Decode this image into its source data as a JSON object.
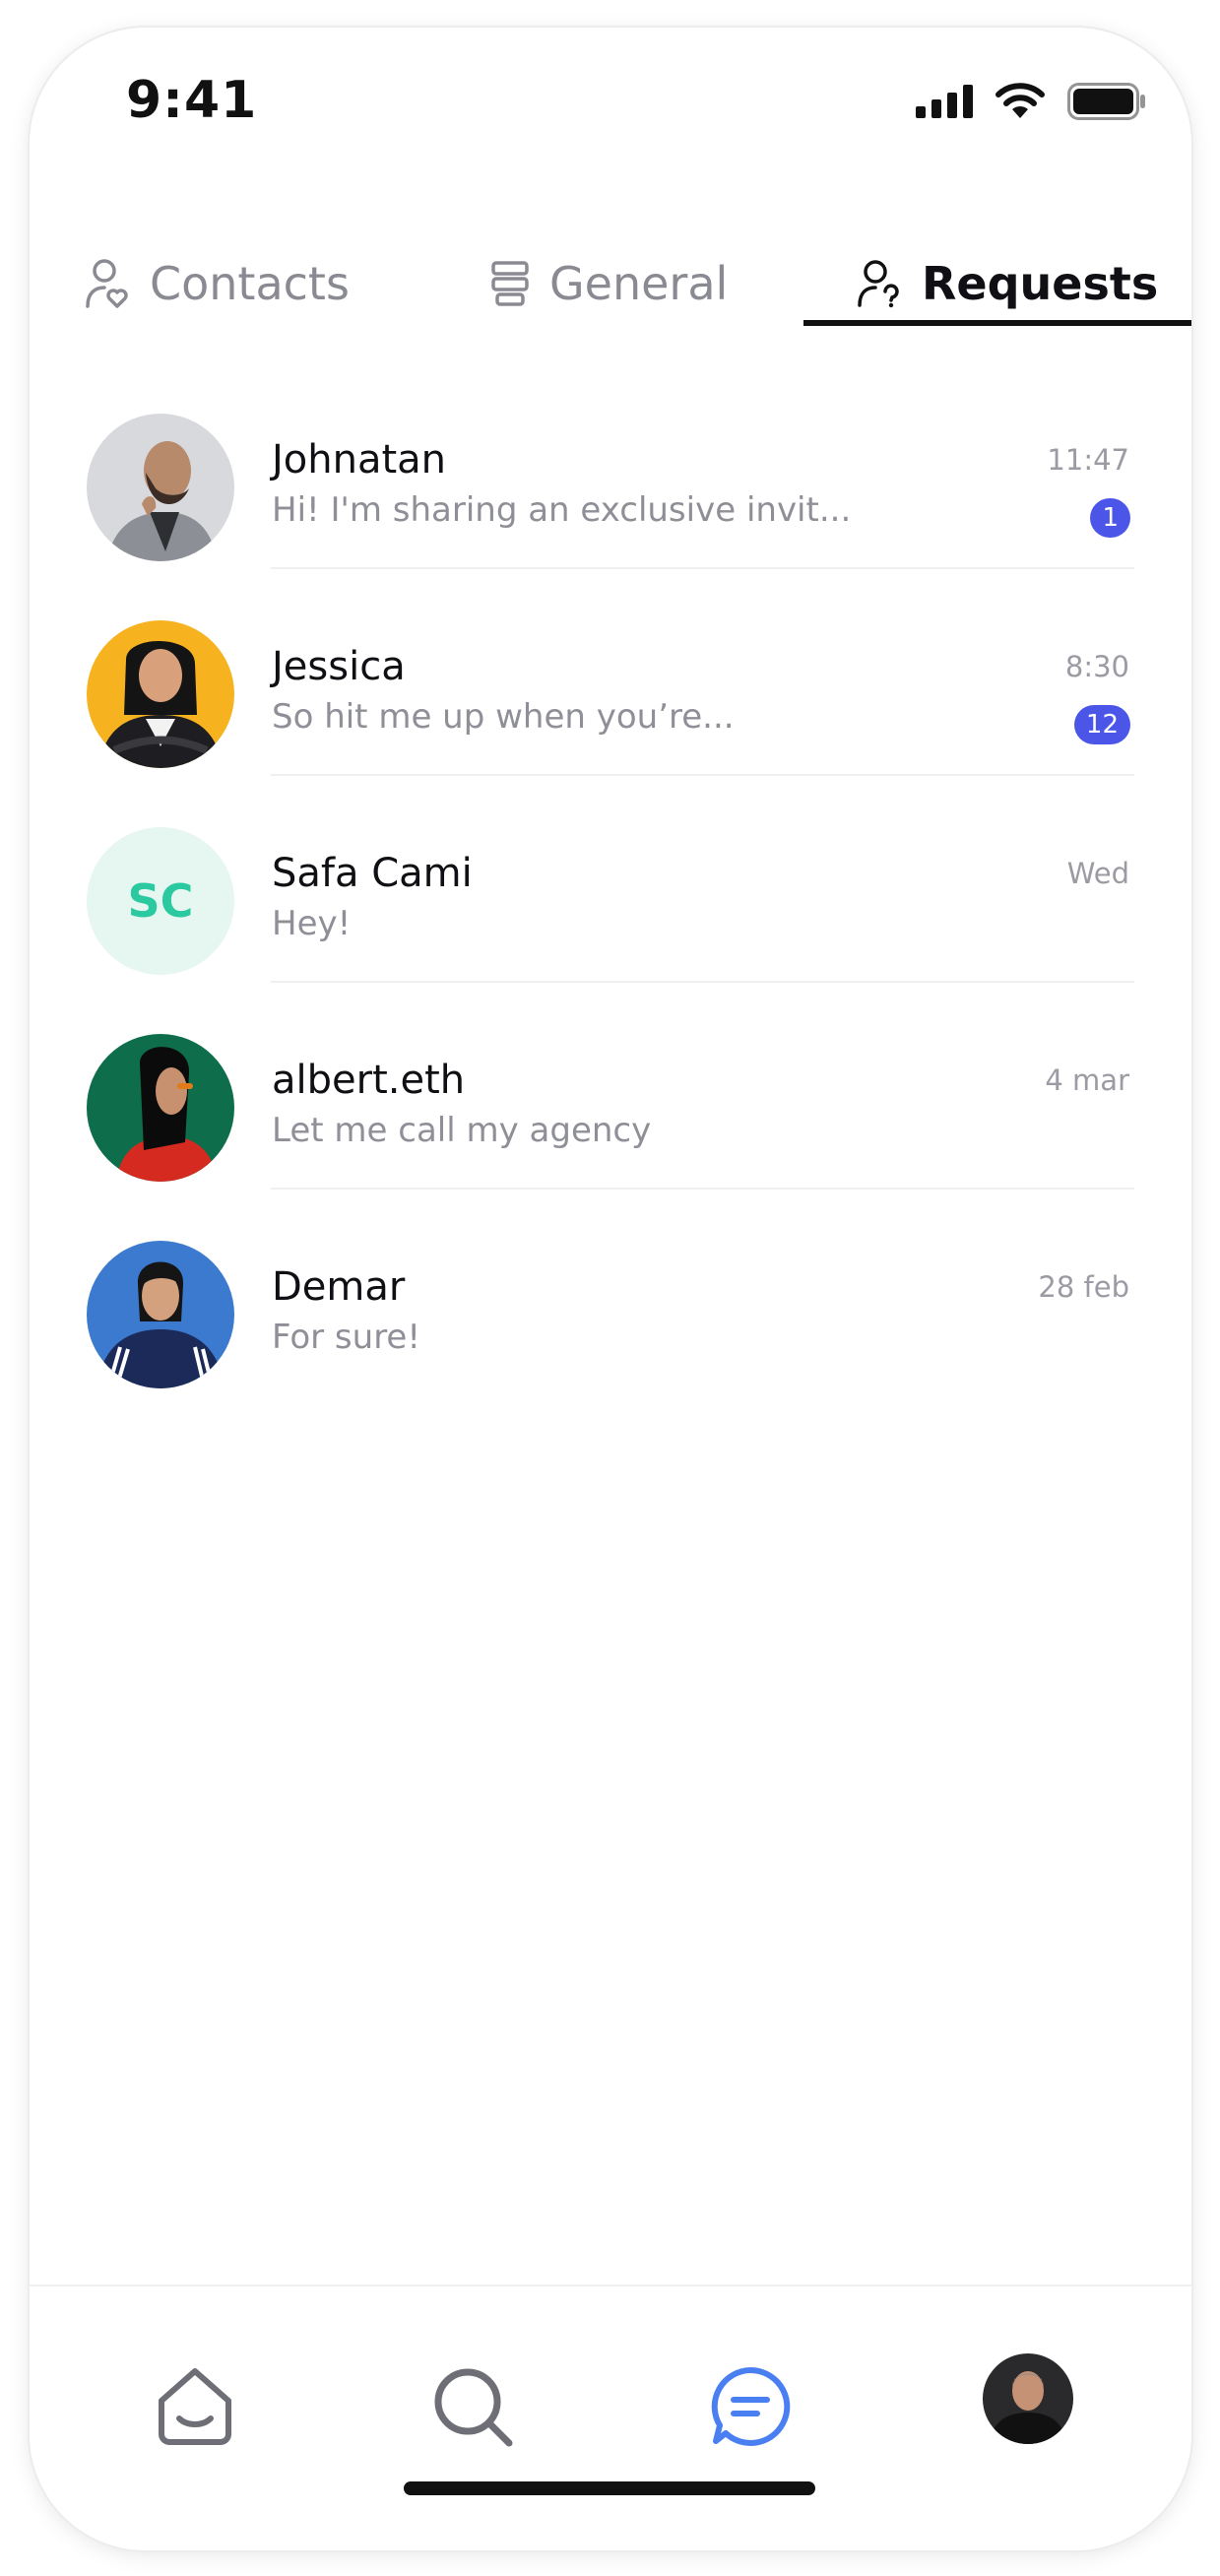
{
  "status_bar": {
    "time": "9:41"
  },
  "tabs": [
    {
      "label": "Contacts",
      "icon": "person-heart-icon",
      "active": false
    },
    {
      "label": "General",
      "icon": "stack-icon",
      "active": false
    },
    {
      "label": "Requests",
      "icon": "person-question-icon",
      "active": true
    }
  ],
  "conversations": [
    {
      "name": "Johnatan",
      "preview": "Hi! I'm sharing an exclusive invit...",
      "time": "11:47",
      "unread": "1",
      "avatar": "photo"
    },
    {
      "name": "Jessica",
      "preview": "So hit me up when you’re...",
      "time": "8:30",
      "unread": "12",
      "avatar": "photo"
    },
    {
      "name": "Safa Cami",
      "preview": "Hey!",
      "time": "Wed",
      "unread": "",
      "avatar": "initials",
      "initials": "SC"
    },
    {
      "name": "albert.eth",
      "preview": "Let me call my agency",
      "time": "4 mar",
      "unread": "",
      "avatar": "photo"
    },
    {
      "name": "Demar",
      "preview": "For sure!",
      "time": "28 feb",
      "unread": "",
      "avatar": "photo"
    }
  ],
  "bottom_nav": [
    {
      "name": "home",
      "icon": "home-icon",
      "active": false
    },
    {
      "name": "search",
      "icon": "search-icon",
      "active": false
    },
    {
      "name": "chat",
      "icon": "chat-icon",
      "active": true
    },
    {
      "name": "profile",
      "icon": "avatar",
      "active": false
    }
  ],
  "colors": {
    "accent": "#4b55e8",
    "chat_active": "#4a7ff2",
    "initials_bg": "#e6f6f1",
    "initials_text": "#2bc9a0"
  }
}
